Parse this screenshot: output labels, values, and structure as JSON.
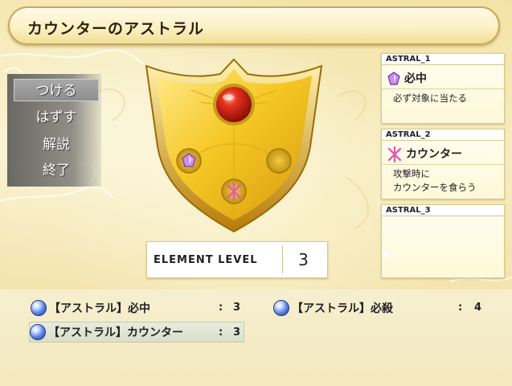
{
  "title": "カウンターのアストラル",
  "menu": {
    "items": [
      {
        "label": "つける",
        "selected": true
      },
      {
        "label": "はずす",
        "selected": false
      },
      {
        "label": "解説",
        "selected": false
      },
      {
        "label": "終了",
        "selected": false
      }
    ]
  },
  "element_level": {
    "label": "ELEMENT LEVEL",
    "value": "3"
  },
  "astral_slots": [
    {
      "header": "ASTRAL_1",
      "name": "必中",
      "icon": "purple-gem-icon",
      "description": "必ず対象に当たる"
    },
    {
      "header": "ASTRAL_2",
      "name": "カウンター",
      "icon": "pink-rune-icon",
      "description": "攻撃時に\nカウンターを食らう"
    },
    {
      "header": "ASTRAL_3",
      "name": "",
      "icon": "",
      "description": ""
    }
  ],
  "skills": [
    {
      "name": "【アストラル】必中",
      "colon": ":",
      "value": "3",
      "selected": false
    },
    {
      "name": "【アストラル】必殺",
      "colon": ":",
      "value": "4",
      "selected": false
    },
    {
      "name": "【アストラル】カウンター",
      "colon": ":",
      "value": "3",
      "selected": true
    }
  ],
  "colors": {
    "shield_gold": "#f2c21e",
    "jewel_red": "#c81e12",
    "orb_blue": "#5c86e6",
    "gem_purple": "#b06fe0",
    "rune_pink": "#e45bb4"
  }
}
